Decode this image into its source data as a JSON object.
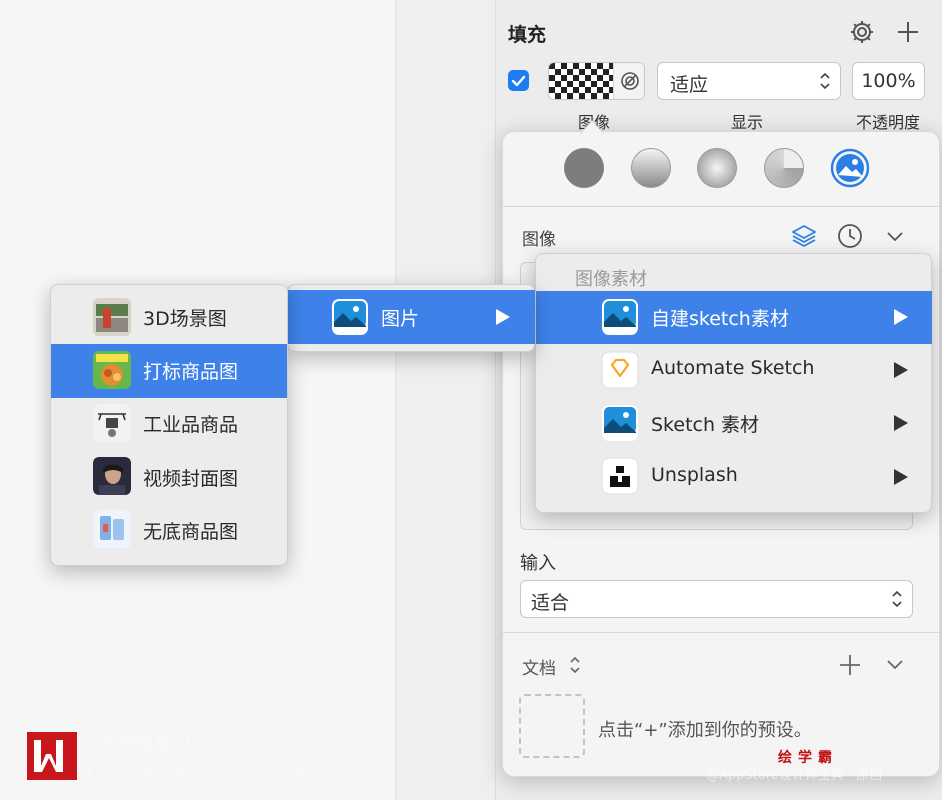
{
  "fill": {
    "title": "填充",
    "display_value": "适应",
    "opacity": "100%",
    "caption_image": "图像",
    "caption_display": "显示",
    "caption_opacity": "不透明度"
  },
  "popover": {
    "section_image": "图像",
    "input_label": "输入",
    "fit_value": "适合",
    "documents_label": "文档",
    "preset_hint": "点击“+”添加到你的预设。"
  },
  "menu_left": {
    "items": [
      {
        "label": "3D场景图"
      },
      {
        "label": "打标商品图"
      },
      {
        "label": "工业品商品"
      },
      {
        "label": "视频封面图"
      },
      {
        "label": "无底商品图"
      }
    ]
  },
  "menu_mid": {
    "items": [
      {
        "label": "图片"
      }
    ]
  },
  "menu_right": {
    "header": "图像素材",
    "items": [
      {
        "label": "自建sketch素材"
      },
      {
        "label": "Automate Sketch"
      },
      {
        "label": "Sketch 素材"
      },
      {
        "label": "Unsplash"
      }
    ]
  },
  "watermark": {
    "org": "王氏教育集团",
    "org_sub": "以人为本",
    "tagline": "精 益 求 精 追 求 卓 越",
    "brand": "绘学霸",
    "bottom": "@AppStore设计师宝典 · 原创"
  },
  "colors": {
    "accent": "#3e82e9",
    "checkbox": "#1e7cf2",
    "watermark_red": "#c01313"
  }
}
